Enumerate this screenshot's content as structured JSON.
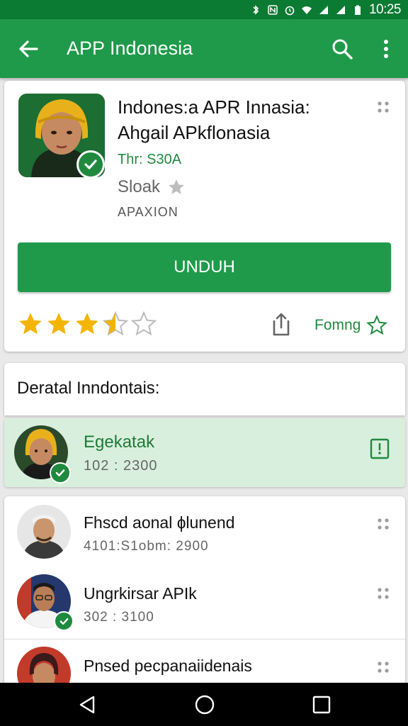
{
  "status_bar": {
    "time": "10:25"
  },
  "app_bar": {
    "title": "APP Indonesia"
  },
  "app": {
    "name_line1": "Indones:a APR Innasia:",
    "name_line2": "Ahgail APkflonasia",
    "developer": "Thr: S30A",
    "size_text": "Sloak",
    "version_text": "APAXION"
  },
  "install_button": {
    "label": "UNDUH"
  },
  "rating": {
    "stars": 3.5,
    "max": 5
  },
  "follow": {
    "label": "Fomng"
  },
  "details": {
    "heading": "Deratal Inndontais:"
  },
  "featured": {
    "name": "Egekatak",
    "meta": "102 : 2300"
  },
  "list_items": [
    {
      "name": "Fhscd aonal ɸlunend",
      "meta": "4101:S1obm: 2900"
    },
    {
      "name": "Ungrkirsar APIk",
      "meta": "302 : 3100"
    },
    {
      "name": "Pnsed pecpanaiidenais",
      "meta": ""
    }
  ],
  "colors": {
    "status_bar": "#0b7a33",
    "app_bar": "#1f9a4a",
    "accent_green": "#1f8a3e",
    "star_gold": "#f4b400",
    "featured_bg": "#d9efdd"
  }
}
